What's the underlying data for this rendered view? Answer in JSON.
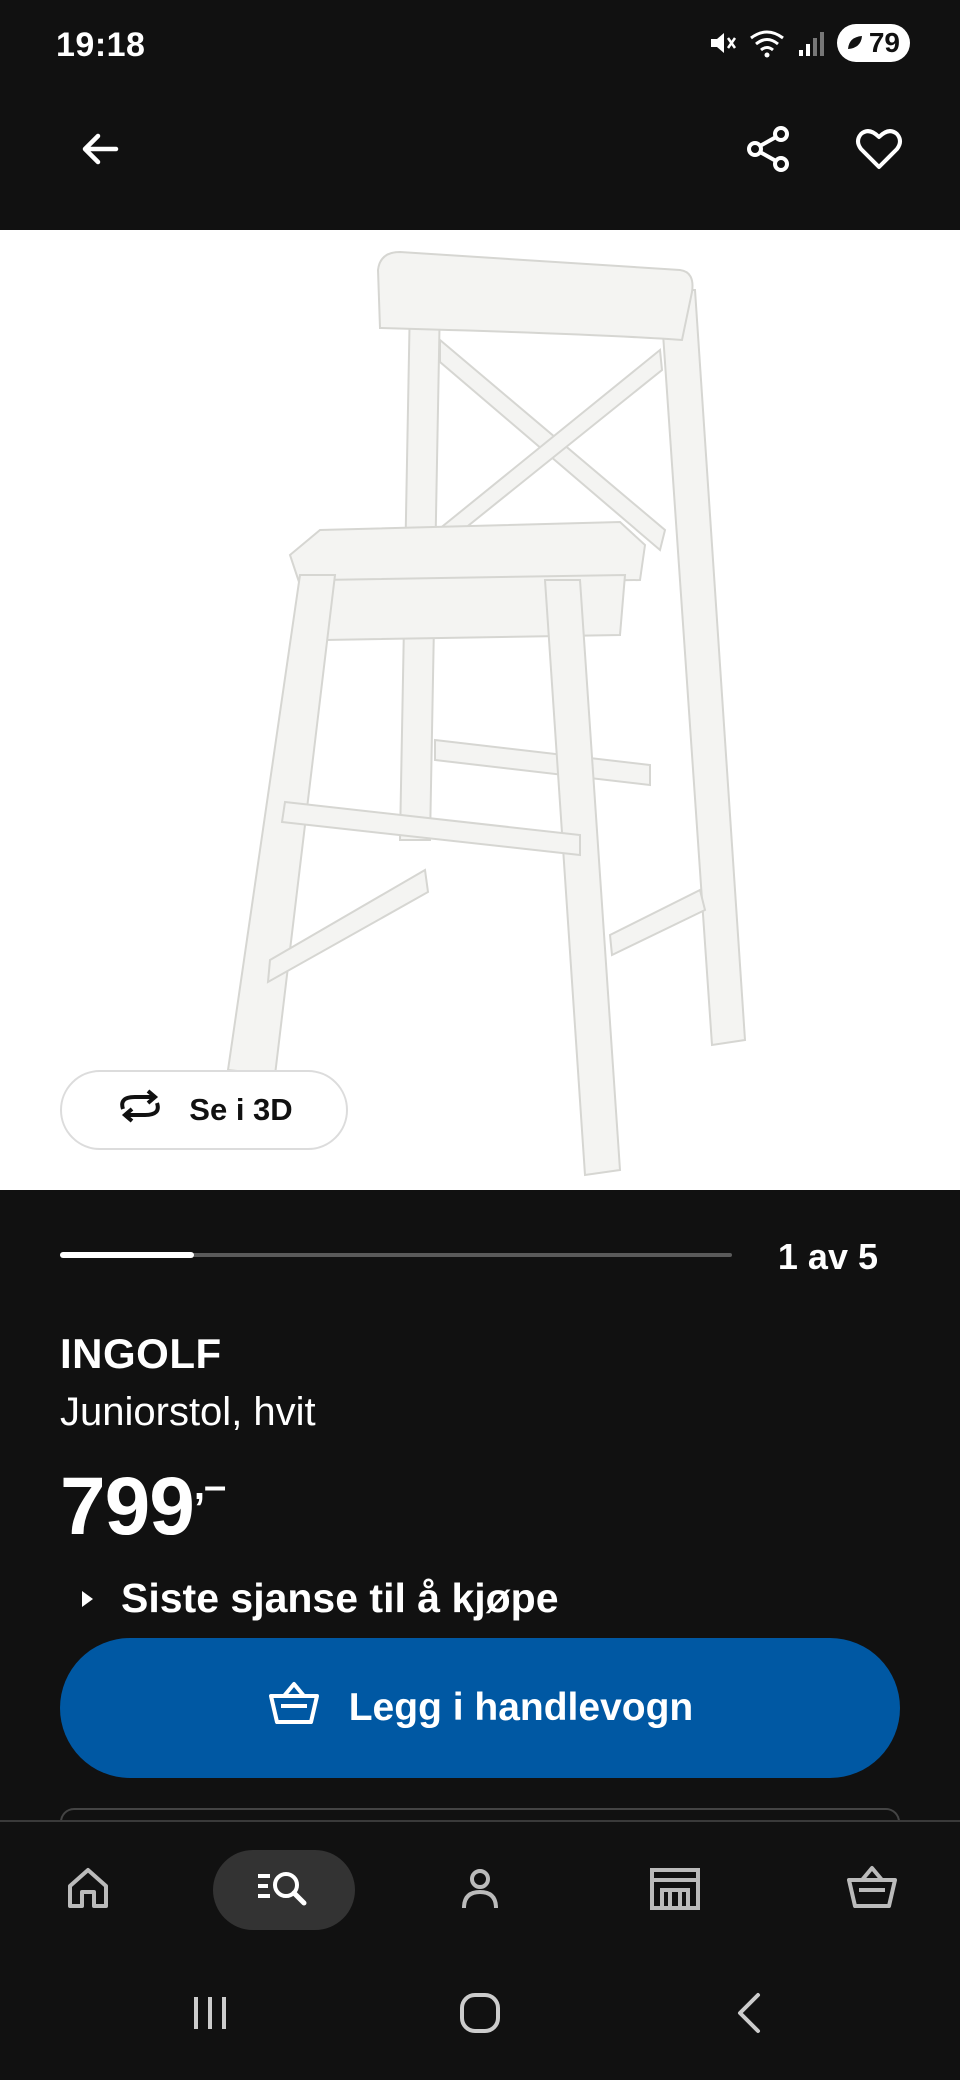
{
  "status_bar": {
    "time": "19:18",
    "battery": "79",
    "icons": [
      "mute-icon",
      "wifi-icon",
      "signal-icon",
      "battery-icon"
    ]
  },
  "app_bar": {
    "icons": [
      "back-arrow-icon",
      "share-icon",
      "heart-icon"
    ]
  },
  "product_image": {
    "view_3d_label": "Se i 3D"
  },
  "carousel": {
    "counter": "1 av 5",
    "progress": 0.2
  },
  "product": {
    "name": "INGOLF",
    "description": "Juniorstol, hvit",
    "price": "799",
    "price_suffix": ",–",
    "availability": "Siste sjanse til å kjøpe"
  },
  "actions": {
    "add_to_cart": "Legg i handlevogn"
  },
  "bottom_nav": {
    "items": [
      "home-icon",
      "search-icon",
      "profile-icon",
      "store-icon",
      "cart-icon"
    ],
    "active": "search-icon"
  },
  "colors": {
    "background": "#111111",
    "primary_button": "#0058a3",
    "text": "#ffffff"
  }
}
